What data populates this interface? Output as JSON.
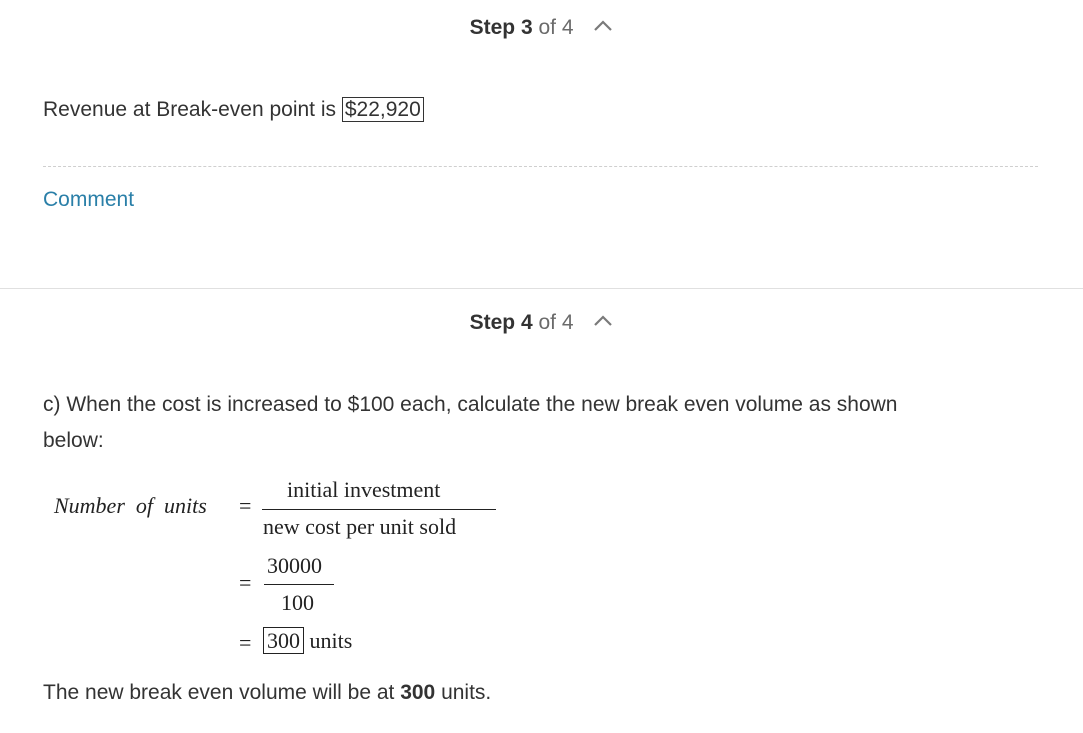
{
  "step3": {
    "step_word": "Step",
    "number": "3",
    "of_text": "of 4",
    "revenue_text": "Revenue at Break-even point is ",
    "revenue_value": "$22,920",
    "comment_label": "Comment"
  },
  "step4": {
    "step_word": "Step",
    "number": "4",
    "of_text": "of 4",
    "intro_line1": "c) When the cost is increased to $100 each, calculate the new break even volume as shown",
    "intro_line2": "below:",
    "equation": {
      "lhs": "Number  of  units",
      "eq": "=",
      "numerator": "initial investment",
      "denominator": "new cost per unit sold",
      "num2": "30000",
      "den2": "100",
      "result": "300",
      "units": "units"
    },
    "conclusion_pre": "The new break even volume will be at ",
    "conclusion_value": "300",
    "conclusion_post": " units."
  }
}
